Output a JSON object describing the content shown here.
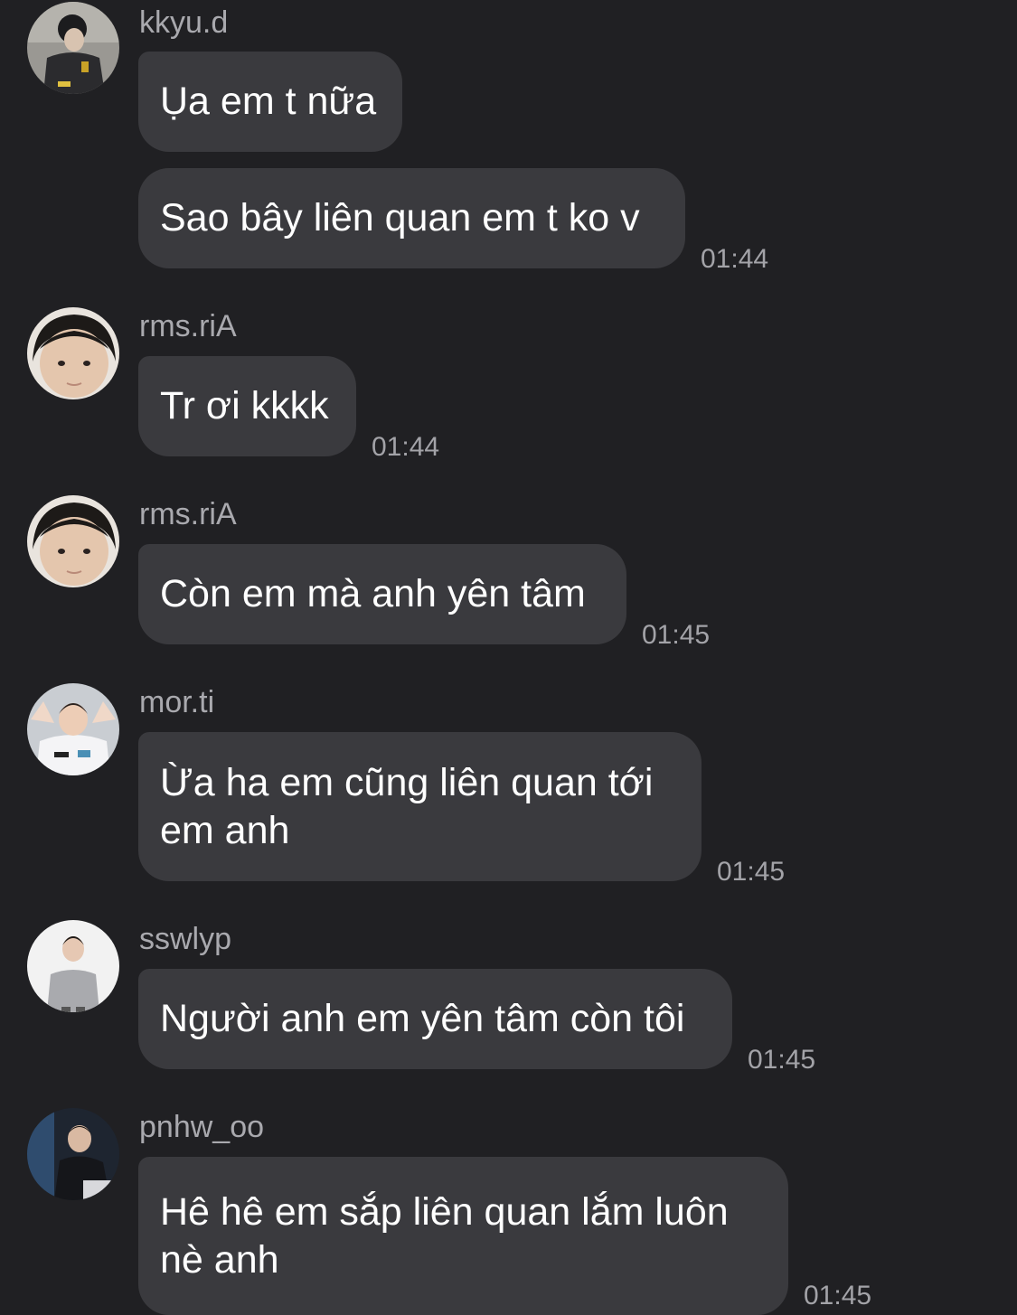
{
  "messages": [
    {
      "sender": "kkyu.d",
      "bubbles": [
        {
          "text": "Ụa em t nữa"
        },
        {
          "text": "Sao bây liên quan em t ko v",
          "time": "01:44"
        }
      ]
    },
    {
      "sender": "rms.riA",
      "bubbles": [
        {
          "text": "Tr ơi kkkk",
          "time": "01:44"
        }
      ]
    },
    {
      "sender": "rms.riA",
      "bubbles": [
        {
          "text": "Còn em mà anh yên tâm",
          "time": "01:45"
        }
      ]
    },
    {
      "sender": "mor.ti",
      "bubbles": [
        {
          "text": "Ừa ha em cũng liên quan tới\nem anh",
          "time": "01:45"
        }
      ]
    },
    {
      "sender": "sswlyp",
      "bubbles": [
        {
          "text": "Người anh em yên tâm còn tôi",
          "time": "01:45"
        }
      ]
    },
    {
      "sender": "pnhw_oo",
      "bubbles": [
        {
          "text": "Hê hê em sắp liên quan lắm luôn\nnè anh",
          "time": "01:45"
        }
      ]
    }
  ],
  "colors": {
    "background": "#202023",
    "bubble": "#3a3a3e",
    "text": "#ffffff",
    "meta": "#a9a9ae"
  }
}
